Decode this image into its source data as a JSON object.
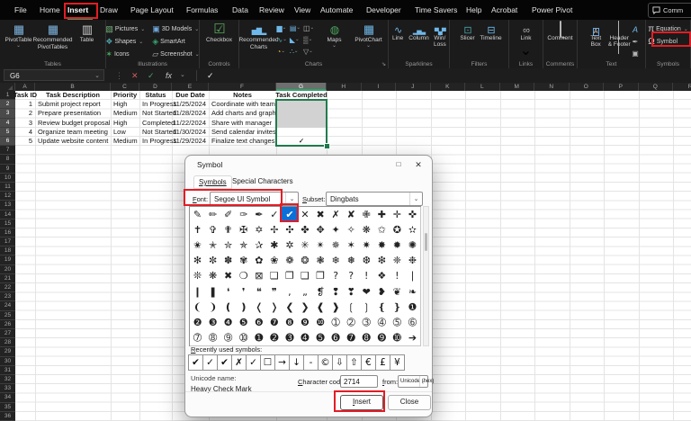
{
  "titlebar": {
    "tabs": [
      "File",
      "Home",
      "Insert",
      "Draw",
      "Page Layout",
      "Formulas",
      "Data",
      "Review",
      "View",
      "Automate",
      "Developer",
      "Time Savers",
      "Help",
      "Acrobat",
      "Power Pivot"
    ],
    "active_tab": "Insert",
    "comments_button": "Comm"
  },
  "ribbon": {
    "groups": [
      {
        "label": "Tables",
        "items": [
          {
            "kind": "lg",
            "label": "PivotTable",
            "icon": "pivottable-icon",
            "chevron": true
          },
          {
            "kind": "lg",
            "label": "Recommended PivotTables",
            "icon": "recommended-pivottables-icon",
            "wrap": true
          },
          {
            "kind": "lg",
            "label": "Table",
            "icon": "table-icon"
          }
        ]
      },
      {
        "label": "Illustrations",
        "items": [
          {
            "kind": "sm",
            "label": "Pictures",
            "icon": "pictures-icon",
            "chevron": true
          },
          {
            "kind": "sm",
            "label": "Shapes",
            "icon": "shapes-icon",
            "chevron": true
          },
          {
            "kind": "sm",
            "label": "Icons",
            "icon": "icons-icon"
          },
          {
            "kind": "sm",
            "label": "3D Models",
            "icon": "3d-models-icon",
            "chevron": true
          },
          {
            "kind": "sm",
            "label": "SmartArt",
            "icon": "smartart-icon"
          },
          {
            "kind": "sm",
            "label": "Screenshot",
            "icon": "screenshot-icon",
            "chevron": true
          }
        ]
      },
      {
        "label": "Controls",
        "items": [
          {
            "kind": "lg",
            "label": "Checkbox",
            "icon": "checkbox-icon"
          }
        ]
      },
      {
        "label": "Charts",
        "launcher": true,
        "items": [
          {
            "kind": "lg",
            "label": "Recommended Charts",
            "icon": "recommended-charts-icon",
            "wrap": true
          },
          {
            "kind": "minigrid",
            "icons": [
              "column-chart-icon",
              "line-chart-icon",
              "pie-chart-icon",
              "hierarchy-chart-icon",
              "area-chart-icon",
              "scatter-chart-icon",
              "combo-chart-icon",
              "surface-chart-icon",
              "funnel-chart-icon"
            ]
          },
          {
            "kind": "lg",
            "label": "Maps",
            "icon": "maps-icon",
            "chevron": true
          },
          {
            "kind": "lg",
            "label": "PivotChart",
            "icon": "pivotchart-icon",
            "chevron": true
          }
        ]
      },
      {
        "label": "Sparklines",
        "items": [
          {
            "kind": "md",
            "label": "Line",
            "icon": "line-sparkline-icon"
          },
          {
            "kind": "md",
            "label": "Column",
            "icon": "column-sparkline-icon"
          },
          {
            "kind": "md",
            "label": "Win/ Loss",
            "icon": "winloss-sparkline-icon",
            "wrap": true
          }
        ]
      },
      {
        "label": "Filters",
        "items": [
          {
            "kind": "md",
            "label": "Slicer",
            "icon": "slicer-icon"
          },
          {
            "kind": "md",
            "label": "Timeline",
            "icon": "timeline-icon"
          }
        ]
      },
      {
        "label": "Links",
        "items": [
          {
            "kind": "md",
            "label": "Link",
            "icon": "link-icon",
            "chevron": true
          }
        ]
      },
      {
        "label": "Comments",
        "items": [
          {
            "kind": "md",
            "label": "Comment",
            "icon": "comment-icon"
          }
        ]
      },
      {
        "label": "Text",
        "items": [
          {
            "kind": "md",
            "label": "Text Box",
            "icon": "text-box-icon",
            "wrap": true
          },
          {
            "kind": "md",
            "label": "Header & Footer",
            "icon": "header-footer-icon",
            "wrap": true
          },
          {
            "kind": "tinycol",
            "icons": [
              "wordart-icon",
              "signature-line-icon",
              "object-icon"
            ]
          }
        ]
      },
      {
        "label": "Symbols",
        "items": [
          {
            "kind": "sm",
            "label": "Equation",
            "icon": "equation-icon",
            "chevron": true
          },
          {
            "kind": "sm",
            "label": "Symbol",
            "icon": "symbol-icon",
            "highlight": true
          }
        ]
      }
    ]
  },
  "formula_bar": {
    "name_box": "G6",
    "formula": "✓"
  },
  "sheet": {
    "col_letters": [
      "A",
      "B",
      "C",
      "D",
      "E",
      "F",
      "G",
      "H",
      "I",
      "J",
      "K",
      "L",
      "M",
      "N",
      "O",
      "P",
      "Q",
      "R"
    ],
    "selected_col": "G",
    "rows_total": 36,
    "selected_rows": [
      2,
      3,
      4,
      5,
      6
    ],
    "header_row": [
      "Task ID",
      "Task Description",
      "Priority",
      "Status",
      "Due Date",
      "Notes",
      "Task Completed"
    ],
    "rows": [
      [
        "1",
        "Submit project report",
        "High",
        "In Progress",
        "11/25/2024",
        "Coordinate with team",
        ""
      ],
      [
        "2",
        "Prepare presentation",
        "Medium",
        "Not Started",
        "11/28/2024",
        "Add charts and graphs",
        ""
      ],
      [
        "3",
        "Review budget proposal",
        "High",
        "Completed",
        "11/22/2024",
        "Share with manager",
        ""
      ],
      [
        "4",
        "Organize team meeting",
        "Low",
        "Not Started",
        "11/30/2024",
        "Send calendar invites",
        ""
      ],
      [
        "5",
        "Update website content",
        "Medium",
        "In Progress",
        "11/29/2024",
        "Finalize text changes",
        "✓"
      ]
    ]
  },
  "dialog": {
    "title": "Symbol",
    "tabs": [
      "Symbols",
      "Special Characters"
    ],
    "active_tab": "Symbols",
    "font_label": "Font:",
    "font_value": "Segoe UI Symbol",
    "subset_label": "Subset:",
    "subset_value": "Dingbats",
    "grid_rows": [
      "✎✏✐✑✒✓✔✕✖✗✘✙✚✛✜",
      "✝✞✟✠✡✢✣✤✥✦✧❋✩✪✫",
      "✬✭✮✯✰✱✲✳✴✵✶✷✸✹✺",
      "✻✼✽✾✿❀❁❂❃❄❅❆❇❈❉",
      "❊❋✖❍⊠❏❐❑❒??!❖!❘",
      "❙❚❛❜❝❞,„❡❢❣❤❥❦❧",
      "❨❩❪❫❬❭❮❯❰❱❲❳❴❵❶",
      "❷❸❹❺❻❼❽❾❿➀➁➂➃➄➅",
      "➆➇➈➉➊➋➌➍➎➏➐➑➒➓➔"
    ],
    "selected_symbol": "✔",
    "selected_row": 0,
    "selected_col": 6,
    "recent_label": "Recently used symbols:",
    "recent": [
      "✔",
      "✓",
      "✔",
      "✗",
      "✓",
      "☐",
      "→",
      "↓",
      "-",
      "©",
      "⇩",
      "⇧",
      "€",
      "£",
      "¥"
    ],
    "unicode_name_label": "Unicode name:",
    "unicode_name": "Heavy Check Mark",
    "char_code_label": "Character code:",
    "char_code": "2714",
    "from_label": "from:",
    "from_value": "Unicode (hex)",
    "insert_button": "Insert",
    "close_button": "Close"
  },
  "colors": {
    "accent_green": "#2ea56b",
    "selection_border": "#1f7c4d",
    "selection_fill": "#d2d2d2",
    "selected_cell_blue": "#0b6fd7",
    "annotation_red": "#e21d25"
  }
}
